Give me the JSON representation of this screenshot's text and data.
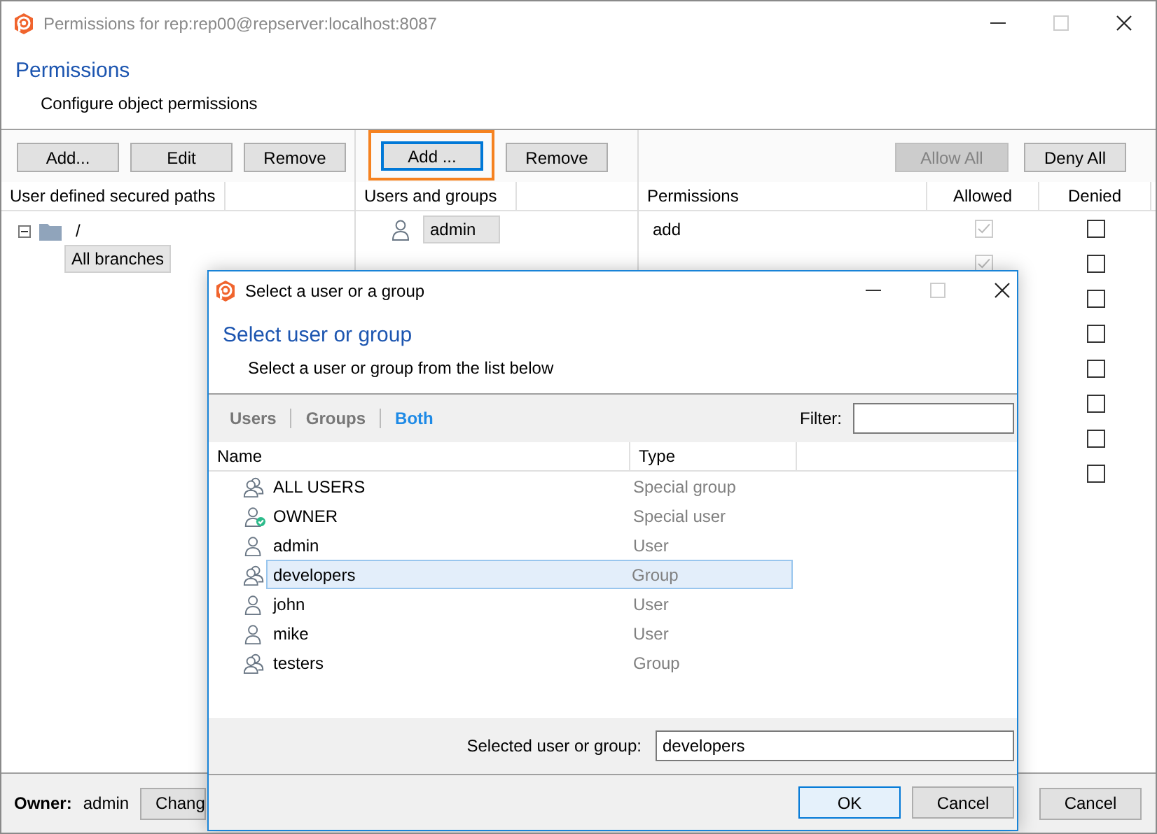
{
  "window": {
    "title": "Permissions for rep:rep00@repserver:localhost:8087"
  },
  "header": {
    "title": "Permissions",
    "subtitle": "Configure object permissions"
  },
  "paths_pane": {
    "buttons": [
      {
        "label": "Add..."
      },
      {
        "label": "Edit"
      },
      {
        "label": "Remove"
      }
    ],
    "column": "User defined secured paths",
    "tree": [
      {
        "label": "/",
        "selected": false,
        "expanded": true,
        "children": [
          {
            "label": "All branches",
            "selected": true
          }
        ]
      }
    ]
  },
  "users_pane": {
    "buttons": [
      {
        "label": "Add ...",
        "focused": true,
        "highlighted": true
      },
      {
        "label": "Remove",
        "focused": false,
        "highlighted": false
      }
    ],
    "column": "Users and groups",
    "items": [
      {
        "label": "admin",
        "selected": true
      }
    ]
  },
  "permissions_pane": {
    "buttons": [
      {
        "label": "Allow All",
        "disabled": true
      },
      {
        "label": "Deny All",
        "disabled": false
      }
    ],
    "columns": [
      "Permissions",
      "Allowed",
      "Denied"
    ],
    "rows": [
      {
        "name": "add",
        "allowed": true,
        "denied": false
      },
      {
        "allowed": true,
        "denied": false
      },
      {
        "denied": false
      },
      {
        "denied": false
      },
      {
        "denied": false
      },
      {
        "denied": false
      },
      {
        "denied": false
      },
      {
        "denied": false
      }
    ]
  },
  "footer": {
    "owner_label": "Owner:",
    "owner": "admin",
    "change_button": "Chang",
    "cancel_button": "Cancel"
  },
  "dialog": {
    "title": "Select a user or a group",
    "heading": "Select user or group",
    "subtitle": "Select a user or group from the list below",
    "filters": [
      {
        "label": "Users",
        "selected": false
      },
      {
        "label": "Groups",
        "selected": false
      },
      {
        "label": "Both",
        "selected": true
      }
    ],
    "filter_label": "Filter:",
    "columns": [
      "Name",
      "Type"
    ],
    "items": [
      {
        "name": "ALL USERS",
        "type": "Special group",
        "kind": "group",
        "selected": false
      },
      {
        "name": "OWNER",
        "type": "Special user",
        "kind": "owner",
        "selected": false
      },
      {
        "name": "admin",
        "type": "User",
        "kind": "user",
        "selected": false
      },
      {
        "name": "developers",
        "type": "Group",
        "kind": "group",
        "selected": true
      },
      {
        "name": "john",
        "type": "User",
        "kind": "user",
        "selected": false
      },
      {
        "name": "mike",
        "type": "User",
        "kind": "user",
        "selected": false
      },
      {
        "name": "testers",
        "type": "Group",
        "kind": "group",
        "selected": false
      }
    ],
    "selection_label": "Selected user or group:",
    "selection_value": "developers",
    "buttons": [
      {
        "label": "OK",
        "default": true
      },
      {
        "label": "Cancel",
        "default": false
      }
    ]
  }
}
